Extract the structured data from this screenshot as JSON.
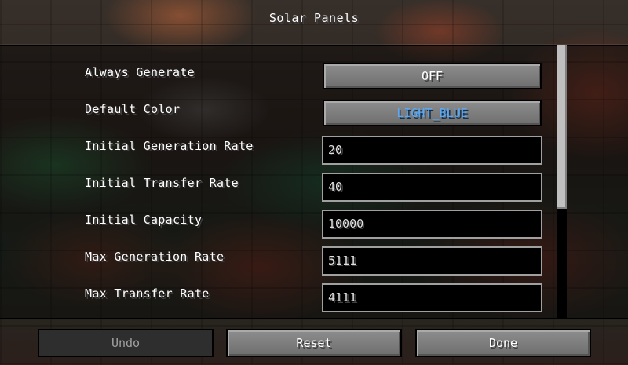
{
  "screen": {
    "title": "Solar Panels"
  },
  "options": [
    {
      "label": "Always Generate",
      "type": "button",
      "value": "OFF"
    },
    {
      "label": "Default Color",
      "type": "button",
      "value": "LIGHT_BLUE",
      "value_color": "#55aaff"
    },
    {
      "label": "Initial Generation Rate",
      "type": "input",
      "value": "20"
    },
    {
      "label": "Initial Transfer Rate",
      "type": "input",
      "value": "40"
    },
    {
      "label": "Initial Capacity",
      "type": "input",
      "value": "10000"
    },
    {
      "label": "Max Generation Rate",
      "type": "input",
      "value": "5111"
    },
    {
      "label": "Max Transfer Rate",
      "type": "input",
      "value": "4111"
    },
    {
      "label": "",
      "type": "input",
      "value": ""
    }
  ],
  "footer": {
    "undo_label": "Undo",
    "reset_label": "Reset",
    "done_label": "Done"
  }
}
